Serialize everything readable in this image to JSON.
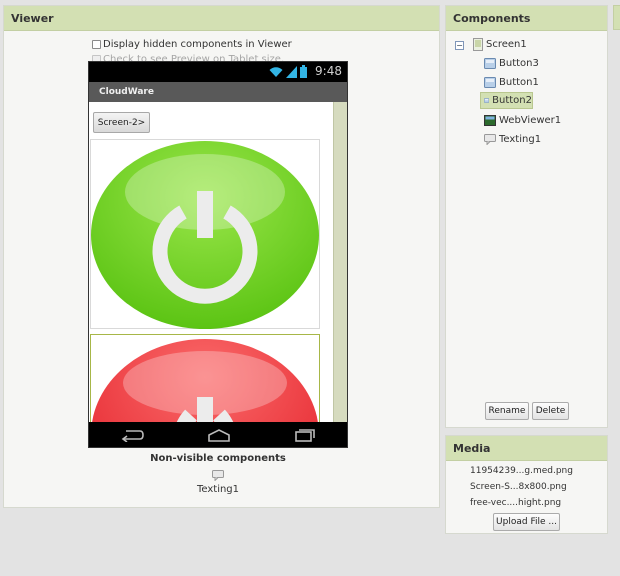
{
  "viewer": {
    "title": "Viewer",
    "checkbox_hidden": "Display hidden components in Viewer",
    "checkbox_tablet": "Check to see Preview on Tablet size.",
    "phone": {
      "clock": "9:48",
      "app_title": "CloudWare",
      "screen_button": "Screen-2>"
    },
    "nonvisible_title": "Non-visible components",
    "nonvisible_items": [
      "Texting1"
    ]
  },
  "components": {
    "title": "Components",
    "tree": [
      {
        "label": "Screen1",
        "icon": "screen-icon"
      },
      {
        "label": "Button3",
        "icon": "button-icon"
      },
      {
        "label": "Button1",
        "icon": "button-icon"
      },
      {
        "label": "Button2",
        "icon": "button-icon",
        "selected": true
      },
      {
        "label": "WebViewer1",
        "icon": "webviewer-icon"
      },
      {
        "label": "Texting1",
        "icon": "texting-icon"
      }
    ],
    "rename_button": "Rename",
    "delete_button": "Delete"
  },
  "media": {
    "title": "Media",
    "files": [
      "11954239...g.med.png",
      "Screen-S...8x800.png",
      "free-vec....hight.png"
    ],
    "upload_button": "Upload File ..."
  },
  "colors": {
    "header": "#d3e0b3",
    "power_green": "#6ccf1f",
    "power_red": "#e8232a"
  }
}
